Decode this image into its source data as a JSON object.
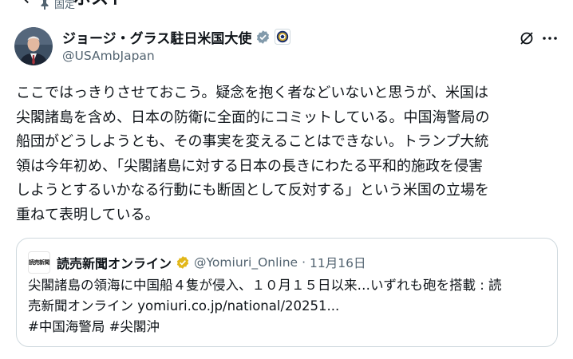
{
  "header": {
    "title": "ポスト",
    "pinned_label": "固定"
  },
  "author": {
    "display_name": "ジョージ・グラス駐日米国大使",
    "handle": "@USAmbJapan"
  },
  "post": {
    "lines": [
      "ここではっきりさせておこう。疑念を抱く者などいないと思うが、米国は",
      "尖閣諸島を含め、日本の防衛に全面的にコミットしている。中国海警局の",
      "船団がどうしようとも、その事実を変えることはできない。トランプ大統",
      "領は今年初め、「尖閣諸島に対する日本の長きにわたる平和的施政を侵害",
      "しようとするいかなる行動にも断固として反対する」という米国の立場を",
      "重ねて表明している。"
    ]
  },
  "quote": {
    "avatar_text": "読売新聞",
    "name": "読売新聞オンライン",
    "handle": "@Yomiuri_Online",
    "separator": "·",
    "date": "11月16日",
    "lines": [
      "尖閣諸島の領海に中国船４隻が侵入、１０月１５日以来…いずれも砲を搭載 : 読",
      "売新聞オンライン yomiuri.co.jp/national/20251...",
      "#中国海警局 #尖閣沖"
    ]
  },
  "colors": {
    "text": "#0f1419",
    "secondary": "#536471",
    "verified_user": "#1d9bf0",
    "verified_org": "#e2b719",
    "border": "#cfd9de"
  },
  "icons": [
    "back-arrow-icon",
    "pin-icon",
    "verified-badge-icon",
    "government-seal-icon",
    "grok-icon",
    "more-icon"
  ]
}
